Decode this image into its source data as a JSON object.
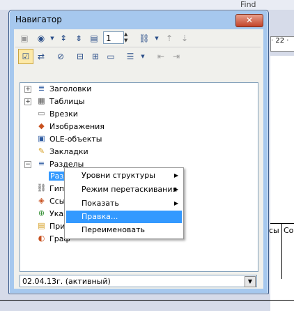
{
  "background": {
    "find_label": "Find",
    "ruler_text": "· 22 ·",
    "cell_text_1": "сы",
    "cell_text_2": "Со"
  },
  "window": {
    "title": "Навигатор",
    "close_label": "✕"
  },
  "toolbar": {
    "page_number": "1"
  },
  "tree": {
    "items": [
      {
        "label": "Заголовки",
        "icon": "headings-icon",
        "expandable": true,
        "expander": "+"
      },
      {
        "label": "Таблицы",
        "icon": "tables-icon",
        "expandable": true,
        "expander": "+"
      },
      {
        "label": "Врезки",
        "icon": "frames-icon",
        "expandable": false
      },
      {
        "label": "Изображения",
        "icon": "images-icon",
        "expandable": false
      },
      {
        "label": "OLE-объекты",
        "icon": "ole-objects-icon",
        "expandable": false
      },
      {
        "label": "Закладки",
        "icon": "bookmarks-icon",
        "expandable": false
      },
      {
        "label": "Разделы",
        "icon": "sections-icon",
        "expandable": true,
        "expander": "−"
      }
    ],
    "selected_child": "Раздел1",
    "partial_items": [
      "Гип",
      "Ссы",
      "Указ",
      "При",
      "Граф"
    ]
  },
  "context_menu": {
    "items": [
      {
        "label": "Уровни структуры",
        "submenu": true,
        "highlighted": false
      },
      {
        "label": "Режим перетаскивания",
        "submenu": true,
        "highlighted": false
      },
      {
        "label": "Показать",
        "submenu": true,
        "highlighted": false
      },
      {
        "label": "Правка...",
        "submenu": false,
        "highlighted": true
      },
      {
        "label": "Переименовать",
        "submenu": false,
        "highlighted": false
      }
    ]
  },
  "document_selector": {
    "value": "02.04.13г. (активный)"
  },
  "colors": {
    "selection": "#3399ff",
    "title_bar": "#a6c8ee",
    "close_button": "#c3432a"
  }
}
